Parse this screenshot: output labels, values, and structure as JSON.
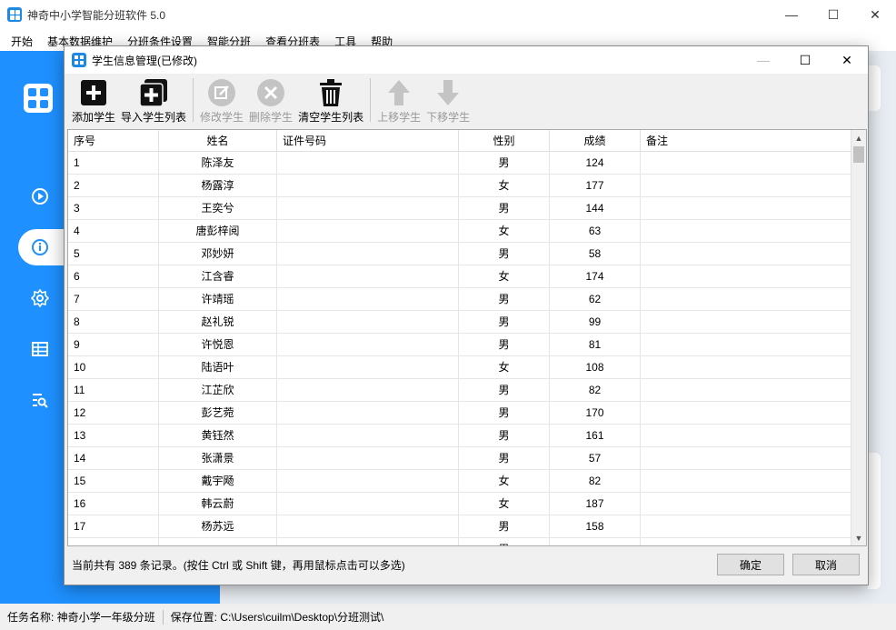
{
  "main": {
    "title": "神奇中小学智能分班软件 5.0",
    "min_glyph": "—",
    "max_glyph": "☐",
    "close_glyph": "✕"
  },
  "menu": [
    "开始",
    "基本数据维护",
    "分班条件设置",
    "智能分班",
    "查看分班表",
    "工具",
    "帮助"
  ],
  "sidebar": {
    "icons": [
      "play-circle-icon",
      "info-circle-icon",
      "gear-icon",
      "table-icon",
      "search-list-icon"
    ],
    "active_index": 1
  },
  "status": {
    "task": "任务名称:  神奇小学一年级分班",
    "save": "保存位置:  C:\\Users\\cuilm\\Desktop\\分班测试\\"
  },
  "dialog": {
    "title": "学生信息管理(已修改)",
    "min_glyph": "—",
    "max_glyph": "☐",
    "close_glyph": "✕",
    "toolbar": {
      "add": "添加学生",
      "import": "导入学生列表",
      "edit": "修改学生",
      "delete": "删除学生",
      "clear": "清空学生列表",
      "up": "上移学生",
      "down": "下移学生"
    },
    "columns": {
      "idx": "序号",
      "name": "姓名",
      "id": "证件号码",
      "sex": "性别",
      "score": "成绩",
      "note": "备注"
    },
    "rows": [
      {
        "idx": "1",
        "name": "陈泽友",
        "id": "",
        "sex": "男",
        "score": "124",
        "note": ""
      },
      {
        "idx": "2",
        "name": "杨露淳",
        "id": "",
        "sex": "女",
        "score": "177",
        "note": ""
      },
      {
        "idx": "3",
        "name": "王奕兮",
        "id": "",
        "sex": "男",
        "score": "144",
        "note": ""
      },
      {
        "idx": "4",
        "name": "唐彭梓阅",
        "id": "",
        "sex": "女",
        "score": "63",
        "note": ""
      },
      {
        "idx": "5",
        "name": "邓妙妍",
        "id": "",
        "sex": "男",
        "score": "58",
        "note": ""
      },
      {
        "idx": "6",
        "name": "江含睿",
        "id": "",
        "sex": "女",
        "score": "174",
        "note": ""
      },
      {
        "idx": "7",
        "name": "许靖瑶",
        "id": "",
        "sex": "男",
        "score": "62",
        "note": ""
      },
      {
        "idx": "8",
        "name": "赵礼锐",
        "id": "",
        "sex": "男",
        "score": "99",
        "note": ""
      },
      {
        "idx": "9",
        "name": "许悦恩",
        "id": "",
        "sex": "男",
        "score": "81",
        "note": ""
      },
      {
        "idx": "10",
        "name": "陆语叶",
        "id": "",
        "sex": "女",
        "score": "108",
        "note": ""
      },
      {
        "idx": "11",
        "name": "江芷欣",
        "id": "",
        "sex": "男",
        "score": "82",
        "note": ""
      },
      {
        "idx": "12",
        "name": "彭艺菀",
        "id": "",
        "sex": "男",
        "score": "170",
        "note": ""
      },
      {
        "idx": "13",
        "name": "黄钰然",
        "id": "",
        "sex": "男",
        "score": "161",
        "note": ""
      },
      {
        "idx": "14",
        "name": "张潇景",
        "id": "",
        "sex": "男",
        "score": "57",
        "note": ""
      },
      {
        "idx": "15",
        "name": "戴宇飏",
        "id": "",
        "sex": "女",
        "score": "82",
        "note": ""
      },
      {
        "idx": "16",
        "name": "韩云蔚",
        "id": "",
        "sex": "女",
        "score": "187",
        "note": ""
      },
      {
        "idx": "17",
        "name": "杨苏远",
        "id": "",
        "sex": "男",
        "score": "158",
        "note": ""
      },
      {
        "idx": "",
        "name": "",
        "id": "",
        "sex": "男",
        "score": "",
        "note": ""
      }
    ],
    "footer": "当前共有 389 条记录。(按住 Ctrl 或 Shift 键，再用鼠标点击可以多选)",
    "ok": "确定",
    "cancel": "取消"
  }
}
